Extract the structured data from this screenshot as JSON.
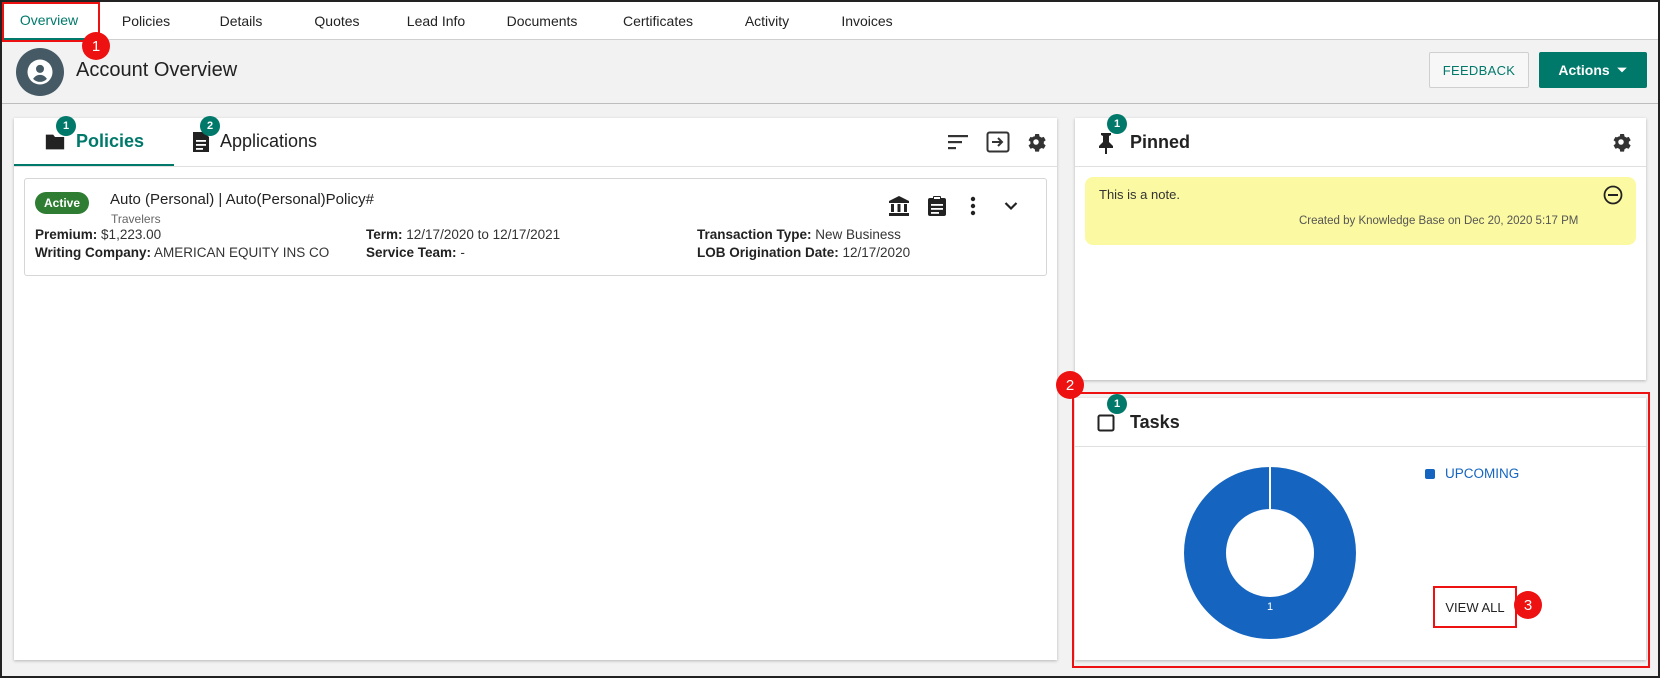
{
  "nav": {
    "tabs": [
      "Overview",
      "Policies",
      "Details",
      "Quotes",
      "Lead Info",
      "Documents",
      "Certificates",
      "Activity",
      "Invoices"
    ]
  },
  "header": {
    "title": "Account Overview",
    "feedback_label": "FEEDBACK",
    "actions_label": "Actions"
  },
  "policies_panel": {
    "tabs": [
      {
        "label": "Policies",
        "badge": "1"
      },
      {
        "label": "Applications",
        "badge": "2"
      }
    ],
    "policy": {
      "status": "Active",
      "title": "Auto (Personal) | Auto(Personal)Policy#",
      "carrier": "Travelers",
      "premium_label": "Premium:",
      "premium": "$1,223.00",
      "writing_company_label": "Writing Company:",
      "writing_company": "AMERICAN EQUITY INS CO",
      "term_label": "Term:",
      "term": "12/17/2020 to 12/17/2021",
      "service_team_label": "Service Team:",
      "service_team": "-",
      "transaction_type_label": "Transaction Type:",
      "transaction_type": "New Business",
      "lob_origination_label": "LOB Origination Date:",
      "lob_origination": "12/17/2020"
    }
  },
  "pinned": {
    "title": "Pinned",
    "badge": "1",
    "note_text": "This is a note.",
    "note_meta": "Created by Knowledge Base on Dec 20, 2020 5:17 PM"
  },
  "tasks": {
    "title": "Tasks",
    "badge": "1",
    "legend_label": "UPCOMING",
    "slice_label": "1",
    "view_all_label": "VIEW ALL"
  },
  "annotations": [
    "1",
    "2",
    "3"
  ],
  "colors": {
    "accent": "#00796b",
    "chart": "#1565c0",
    "annotation": "#ee1111",
    "note": "#fbf9a2"
  }
}
